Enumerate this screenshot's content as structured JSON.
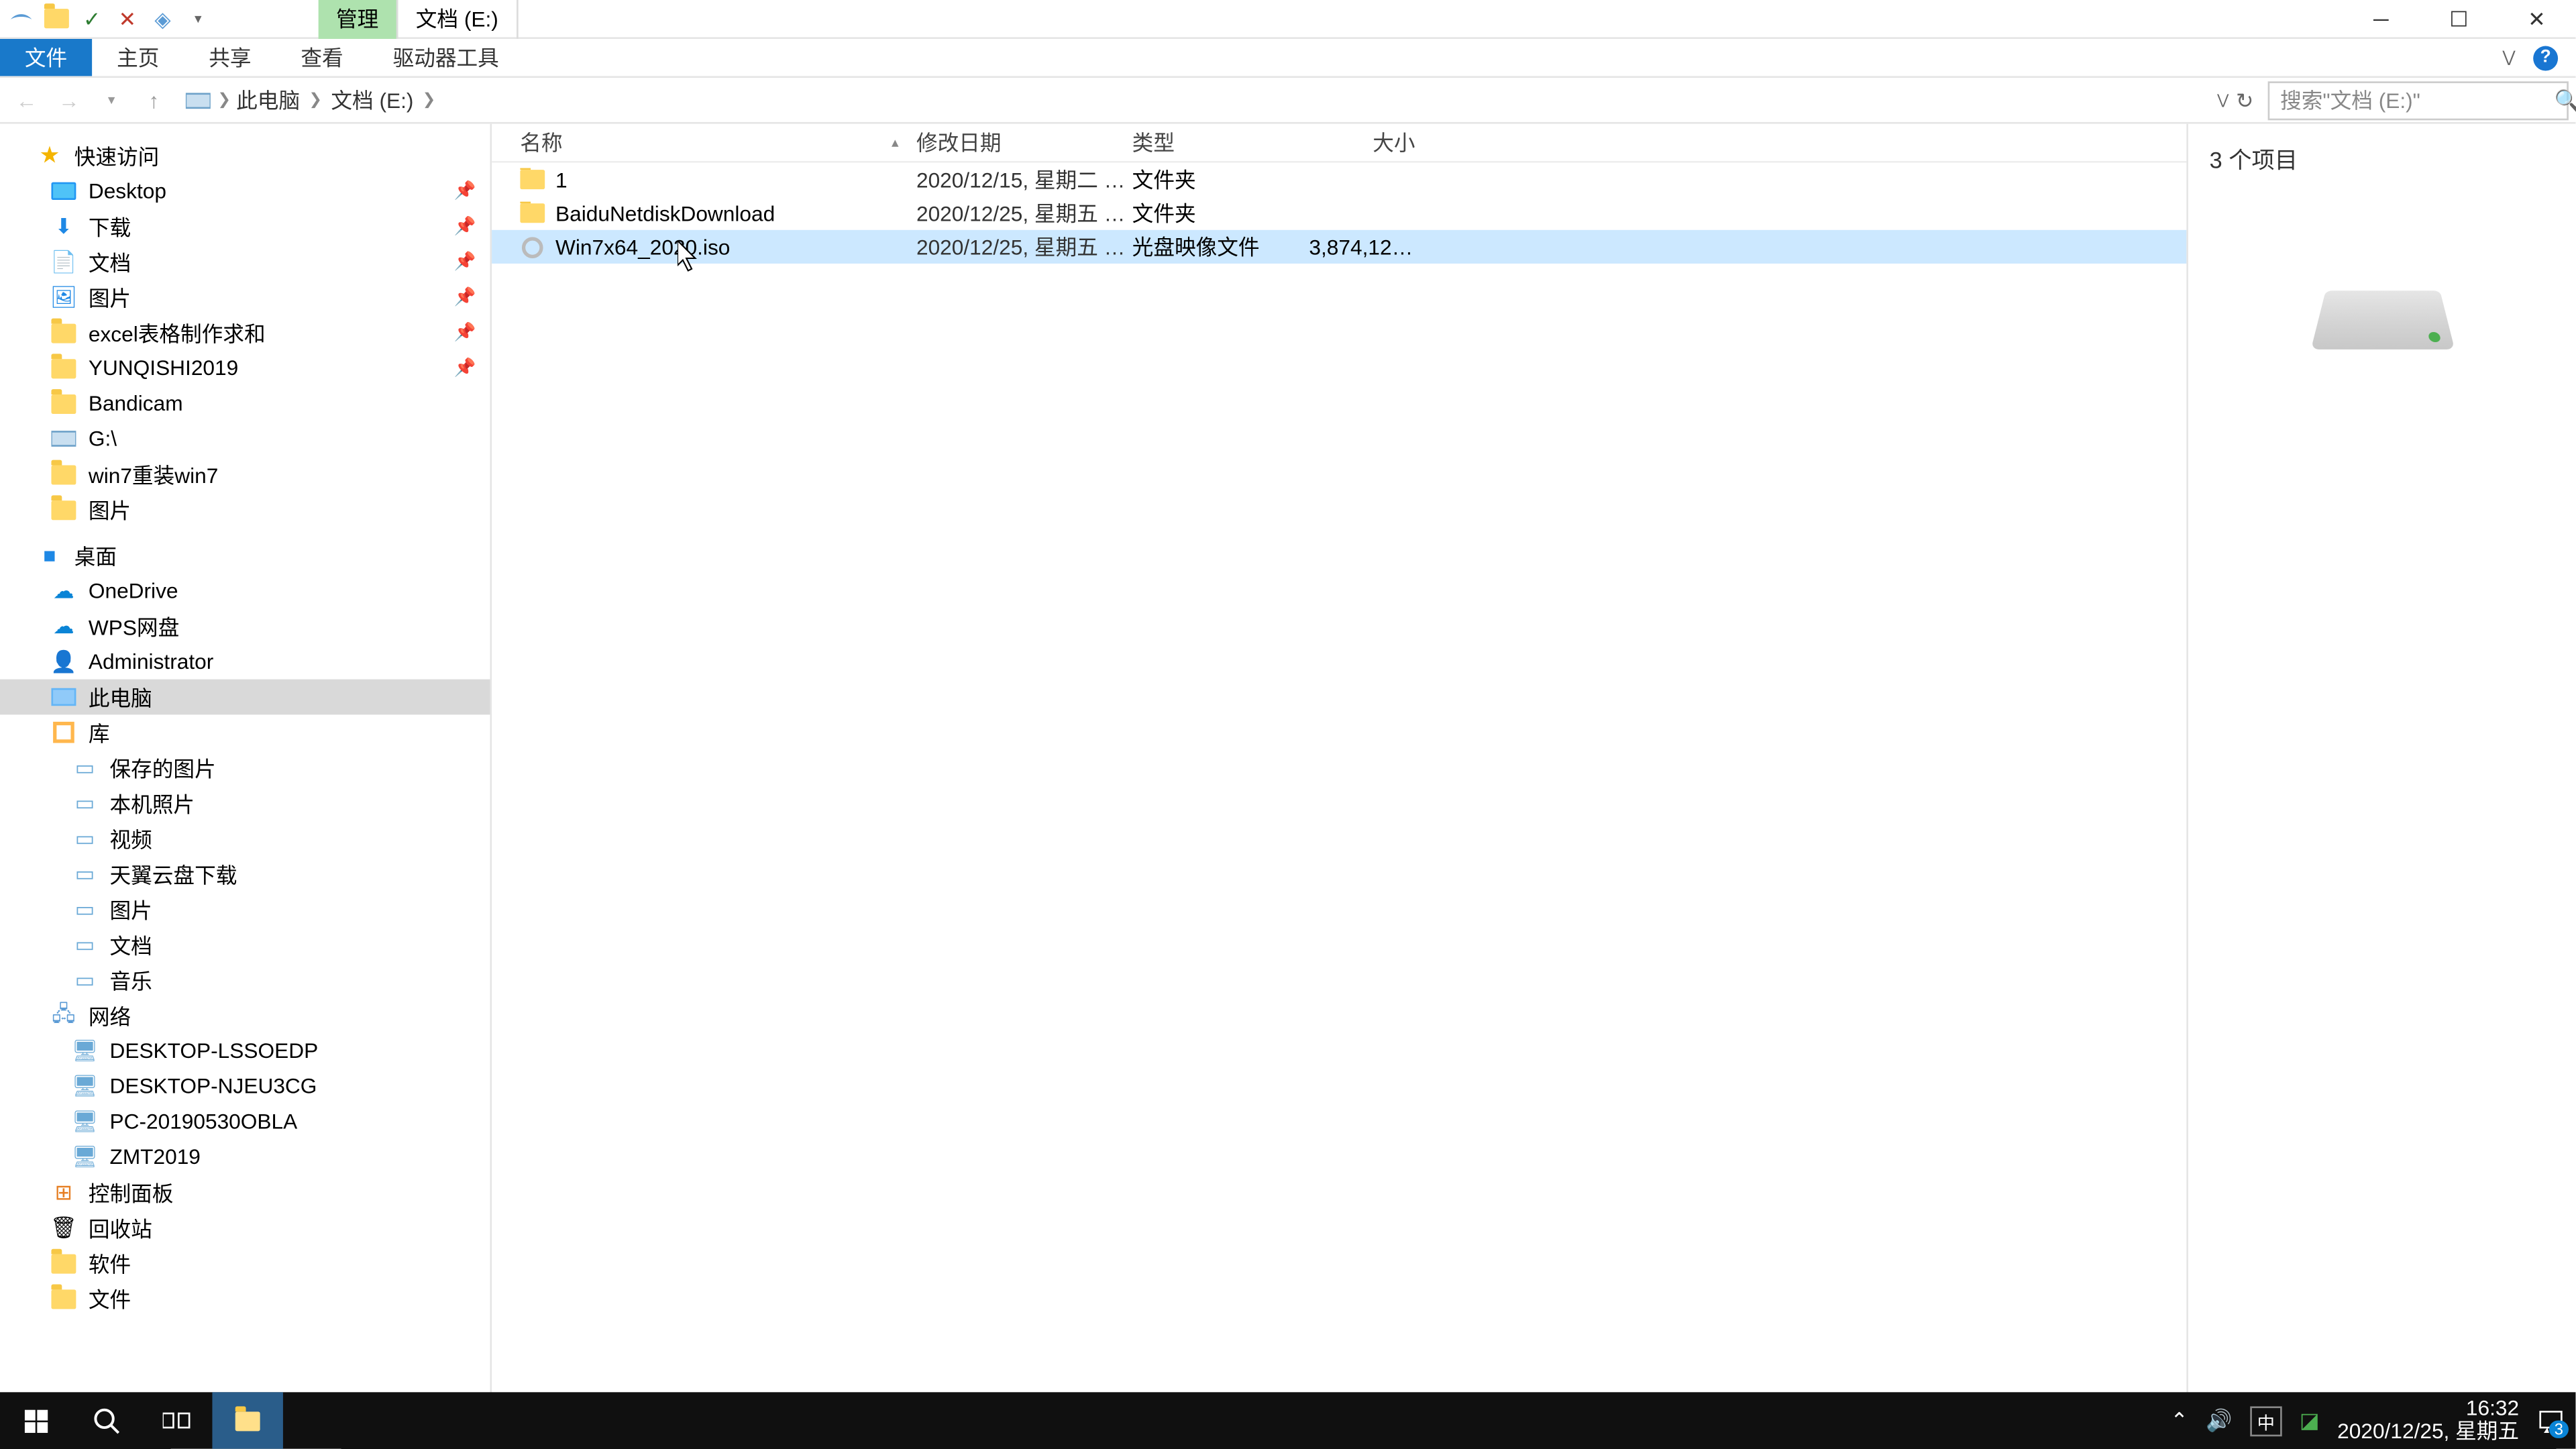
{
  "title": {
    "manage_tab": "管理",
    "location_tab": "文档 (E:)"
  },
  "ribbon": {
    "file": "文件",
    "home": "主页",
    "share": "共享",
    "view": "查看",
    "drive_tools": "驱动器工具"
  },
  "breadcrumb": {
    "this_pc": "此电脑",
    "drive": "文档 (E:)"
  },
  "search": {
    "placeholder": "搜索\"文档 (E:)\""
  },
  "sidebar": {
    "quick_access": "快速访问",
    "quick_items": [
      {
        "label": "Desktop",
        "icon": "desktop",
        "pin": true
      },
      {
        "label": "下载",
        "icon": "download",
        "pin": true
      },
      {
        "label": "文档",
        "icon": "doc",
        "pin": true
      },
      {
        "label": "图片",
        "icon": "picture",
        "pin": true
      },
      {
        "label": "excel表格制作求和",
        "icon": "folder",
        "pin": true
      },
      {
        "label": "YUNQISHI2019",
        "icon": "folder",
        "pin": true
      },
      {
        "label": "Bandicam",
        "icon": "folder",
        "pin": false
      },
      {
        "label": "G:\\",
        "icon": "drive",
        "pin": false
      },
      {
        "label": "win7重装win7",
        "icon": "folder",
        "pin": false
      },
      {
        "label": "图片",
        "icon": "folder",
        "pin": false
      }
    ],
    "desktop": "桌面",
    "desktop_items": [
      {
        "label": "OneDrive",
        "icon": "onedrive"
      },
      {
        "label": "WPS网盘",
        "icon": "wps"
      },
      {
        "label": "Administrator",
        "icon": "user"
      },
      {
        "label": "此电脑",
        "icon": "pc",
        "selected": true
      },
      {
        "label": "库",
        "icon": "lib"
      }
    ],
    "library_items": [
      {
        "label": "保存的图片"
      },
      {
        "label": "本机照片"
      },
      {
        "label": "视频"
      },
      {
        "label": "天翼云盘下载"
      },
      {
        "label": "图片"
      },
      {
        "label": "文档"
      },
      {
        "label": "音乐"
      }
    ],
    "network": "网络",
    "network_items": [
      {
        "label": "DESKTOP-LSSOEDP"
      },
      {
        "label": "DESKTOP-NJEU3CG"
      },
      {
        "label": "PC-20190530OBLA"
      },
      {
        "label": "ZMT2019"
      }
    ],
    "control_panel": "控制面板",
    "recycle": "回收站",
    "software": "软件",
    "files": "文件"
  },
  "columns": {
    "name": "名称",
    "date": "修改日期",
    "type": "类型",
    "size": "大小"
  },
  "rows": [
    {
      "name": "1",
      "date": "2020/12/15, 星期二 1...",
      "type": "文件夹",
      "size": "",
      "icon": "folder",
      "selected": false
    },
    {
      "name": "BaiduNetdiskDownload",
      "date": "2020/12/25, 星期五 1...",
      "type": "文件夹",
      "size": "",
      "icon": "folder",
      "selected": false
    },
    {
      "name": "Win7x64_2020.iso",
      "date": "2020/12/25, 星期五 1...",
      "type": "光盘映像文件",
      "size": "3,874,126...",
      "icon": "iso",
      "selected": true
    }
  ],
  "details": {
    "count": "3 个项目"
  },
  "statusbar": {
    "text": "3 个项目"
  },
  "tray": {
    "ime": "中",
    "time": "16:32",
    "date": "2020/12/25, 星期五",
    "badge": "3"
  }
}
